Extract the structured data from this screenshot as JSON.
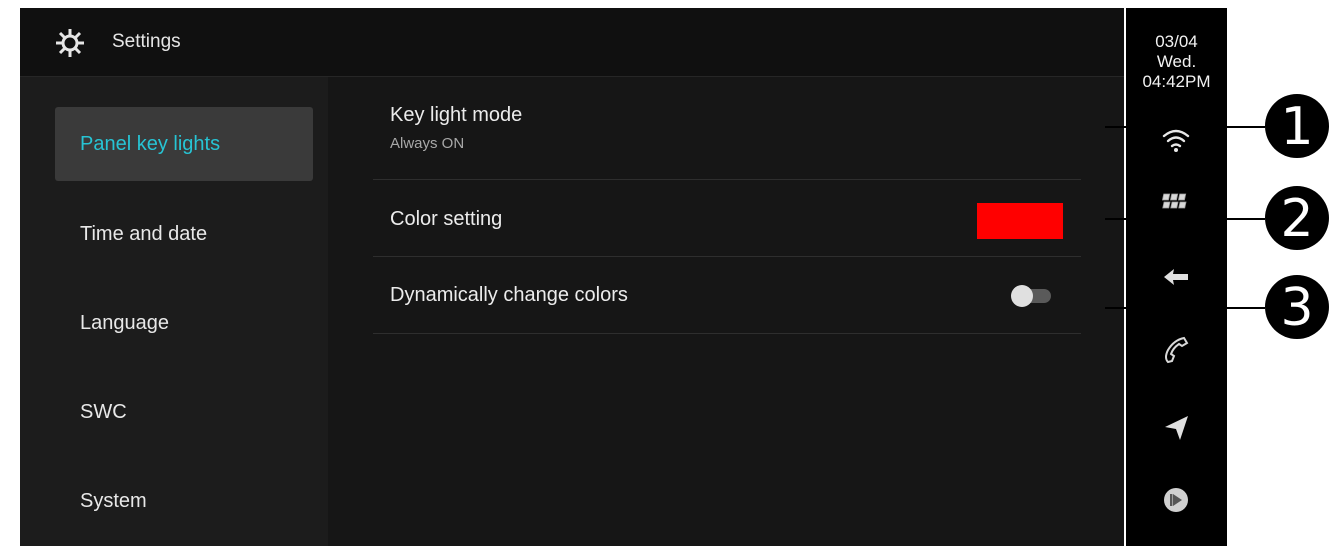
{
  "header": {
    "title": "Settings",
    "icon": "gear-icon"
  },
  "sidebar": {
    "items": [
      {
        "label": "Panel key lights",
        "active": true
      },
      {
        "label": "Time and date"
      },
      {
        "label": "Language"
      },
      {
        "label": "SWC"
      },
      {
        "label": "System"
      }
    ]
  },
  "settings": {
    "key_light_mode": {
      "title": "Key light mode",
      "value": "Always ON"
    },
    "color_setting": {
      "title": "Color setting",
      "color": "#ff0000"
    },
    "dynamic_colors": {
      "title": "Dynamically change colors",
      "enabled": false
    }
  },
  "statusbar": {
    "date": "03/04",
    "day": "Wed.",
    "time": "04:42PM",
    "icons": [
      "wifi-icon",
      "apps-grid-icon",
      "back-icon",
      "phone-icon",
      "navigation-icon",
      "media-icon"
    ]
  },
  "callouts": [
    "1",
    "2",
    "3"
  ],
  "colors": {
    "accent": "#27c4d4",
    "background": "#161616",
    "swatch": "#ff0000"
  }
}
